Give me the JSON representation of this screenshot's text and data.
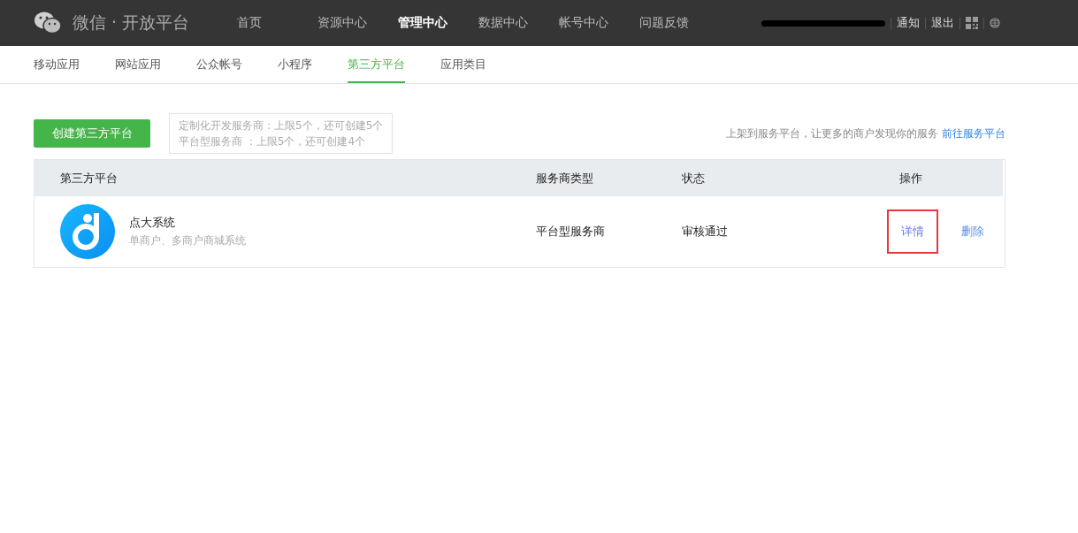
{
  "header": {
    "logo_text": "微信 · 开放平台",
    "nav": [
      {
        "label": "首页",
        "selected": false
      },
      {
        "label": "资源中心",
        "selected": false
      },
      {
        "label": "管理中心",
        "selected": true
      },
      {
        "label": "数据中心",
        "selected": false
      },
      {
        "label": "帐号中心",
        "selected": false
      },
      {
        "label": "问题反馈",
        "selected": false
      }
    ],
    "account_links": [
      "通知",
      "退出"
    ]
  },
  "subnav": [
    {
      "label": "移动应用",
      "selected": false
    },
    {
      "label": "网站应用",
      "selected": false
    },
    {
      "label": "公众帐号",
      "selected": false
    },
    {
      "label": "小程序",
      "selected": false
    },
    {
      "label": "第三方平台",
      "selected": true
    },
    {
      "label": "应用类目",
      "selected": false
    }
  ],
  "create_button": "创建第三方平台",
  "quota_tip": [
    "定制化开发服务商：上限5个，还可创建5个",
    "平台型服务商 ：上限5个，还可创建4个"
  ],
  "promo": {
    "text": "上架到服务平台，让更多的商户发现你的服务",
    "link": "前往服务平台"
  },
  "table": {
    "columns": [
      "第三方平台",
      "服务商类型",
      "状态",
      "操作"
    ],
    "rows": [
      {
        "name": "点大系统",
        "description": "单商户、多商户商城系统",
        "type": "平台型服务商",
        "status": "审核通过",
        "actions": [
          {
            "label": "详情",
            "highlighted": true
          },
          {
            "label": "删除",
            "highlighted": false
          }
        ]
      }
    ]
  }
}
